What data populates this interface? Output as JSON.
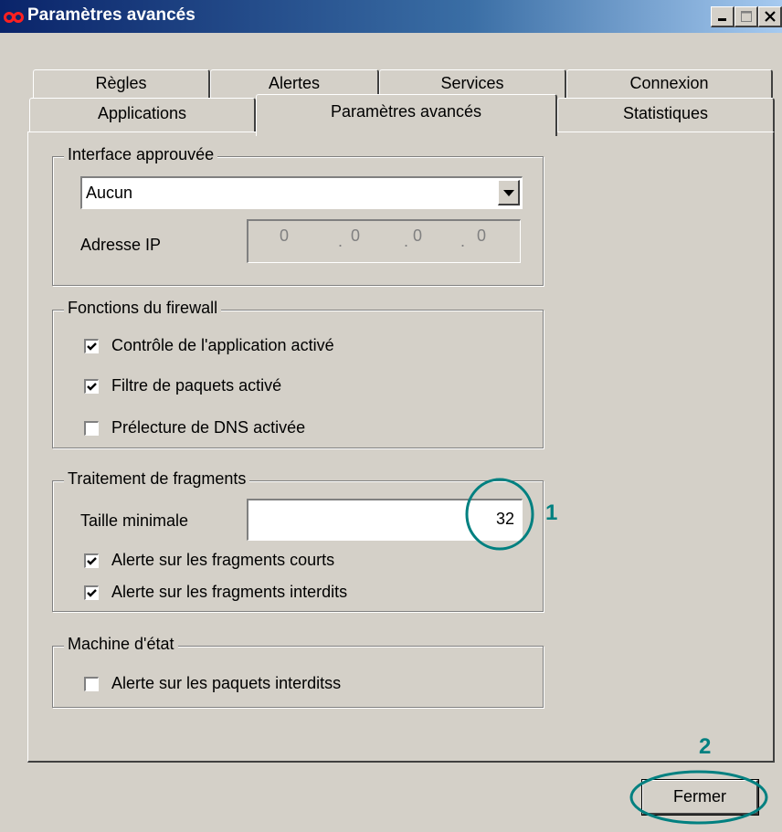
{
  "window": {
    "title": "Paramètres avancés"
  },
  "tabs": {
    "row1": [
      "Règles",
      "Alertes",
      "Services",
      "Connexion"
    ],
    "row2": [
      "Applications",
      "Paramètres avancés",
      "Statistiques"
    ]
  },
  "interface_group": {
    "title": "Interface approuvée",
    "combo_value": "Aucun",
    "ip_label": "Adresse IP",
    "ip_parts": [
      "0",
      "0",
      "0",
      "0"
    ]
  },
  "firewall_group": {
    "title": "Fonctions du firewall",
    "items": [
      {
        "label": "Contrôle de l'application activé",
        "checked": true
      },
      {
        "label": "Filtre de paquets activé",
        "checked": true
      },
      {
        "label": "Prélecture de DNS activée",
        "checked": false
      }
    ]
  },
  "fragments_group": {
    "title": "Traitement de fragments",
    "min_size_label": "Taille minimale",
    "min_size_value": "32",
    "items": [
      {
        "label": "Alerte sur les fragments courts",
        "checked": true
      },
      {
        "label": "Alerte sur les fragments interdits",
        "checked": true
      }
    ]
  },
  "state_group": {
    "title": "Machine d'état",
    "items": [
      {
        "label": "Alerte sur les paquets interditss",
        "checked": false
      }
    ]
  },
  "footer": {
    "close_label": "Fermer"
  },
  "annotations": {
    "marker1": "1",
    "marker2": "2",
    "color": "#008080"
  },
  "colors": {
    "face": "#d4d0c8",
    "titlebar_start": "#0a246a",
    "titlebar_end": "#a6caf0"
  }
}
